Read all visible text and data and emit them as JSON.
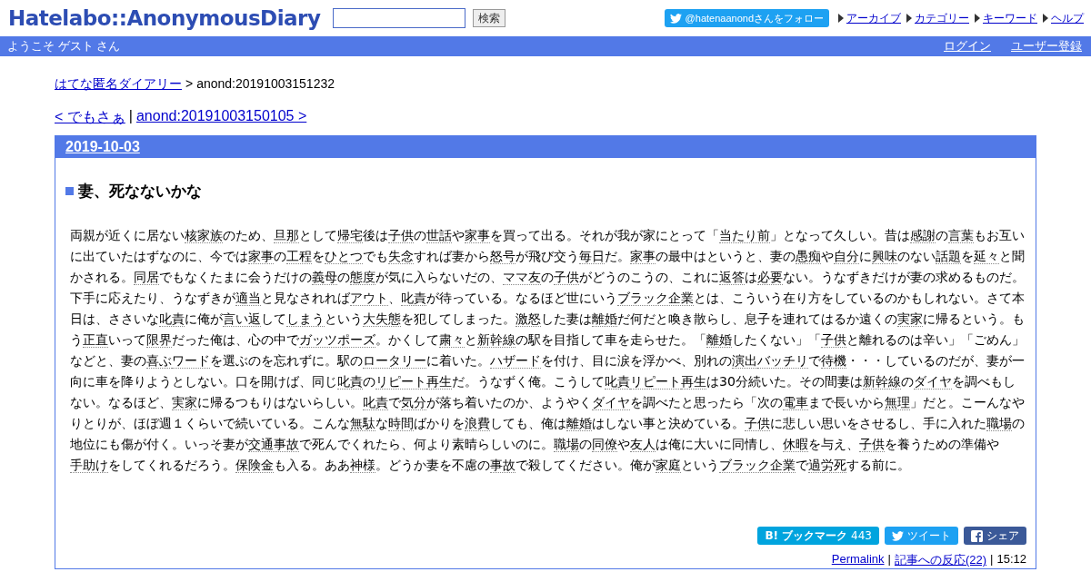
{
  "header": {
    "logo": "Hatelabo::AnonymousDiary",
    "search": {
      "button": "検索"
    },
    "follow": "@hatenaanondさんをフォロー",
    "links": [
      "アーカイブ",
      "カテゴリー",
      "キーワード",
      "ヘルプ"
    ]
  },
  "user_bar": {
    "greeting": "ようこそ ゲスト さん",
    "links": [
      "ログイン",
      "ユーザー登録"
    ]
  },
  "breadcrumb": {
    "link": "はてな匿名ダイアリー",
    "separator": ">",
    "current": "anond:20191003151232"
  },
  "pager": {
    "prev": "< でもさぁ",
    "separator": "|",
    "next": "anond:20191003150105 >"
  },
  "day": {
    "date": "2019-10-03",
    "entry": {
      "title": "妻、死なないかな",
      "body": [
        {
          "text": "両親が近くに居ない",
          "keyword": false
        },
        {
          "text": "核家族",
          "keyword": true
        },
        {
          "text": "のため、",
          "keyword": false
        },
        {
          "text": "旦那",
          "keyword": true
        },
        {
          "text": "として",
          "keyword": false
        },
        {
          "text": "帰宅",
          "keyword": true
        },
        {
          "text": "後は",
          "keyword": false
        },
        {
          "text": "子供",
          "keyword": true
        },
        {
          "text": "の",
          "keyword": false
        },
        {
          "text": "世話",
          "keyword": true
        },
        {
          "text": "や",
          "keyword": false
        },
        {
          "text": "家事",
          "keyword": true
        },
        {
          "text": "を買って出る。それが我が家にとって「",
          "keyword": false
        },
        {
          "text": "当たり前",
          "keyword": true
        },
        {
          "text": "」となって久しい。昔は",
          "keyword": false
        },
        {
          "text": "感謝",
          "keyword": true
        },
        {
          "text": "の",
          "keyword": false
        },
        {
          "text": "言葉",
          "keyword": true
        },
        {
          "text": "もお互いに出ていたはずなのに、今では",
          "keyword": false
        },
        {
          "text": "家事",
          "keyword": true
        },
        {
          "text": "の",
          "keyword": false
        },
        {
          "text": "工程",
          "keyword": true
        },
        {
          "text": "を",
          "keyword": false
        },
        {
          "text": "ひとつ",
          "keyword": true
        },
        {
          "text": "でも",
          "keyword": false
        },
        {
          "text": "失念",
          "keyword": true
        },
        {
          "text": "すれば妻から",
          "keyword": false
        },
        {
          "text": "怒号",
          "keyword": true
        },
        {
          "text": "が飛び交う",
          "keyword": false
        },
        {
          "text": "毎日",
          "keyword": true
        },
        {
          "text": "だ。",
          "keyword": false
        },
        {
          "text": "家事",
          "keyword": true
        },
        {
          "text": "の最中はというと、妻の",
          "keyword": false
        },
        {
          "text": "愚痴",
          "keyword": true
        },
        {
          "text": "や",
          "keyword": false
        },
        {
          "text": "自分",
          "keyword": true
        },
        {
          "text": "に",
          "keyword": false
        },
        {
          "text": "興味",
          "keyword": true
        },
        {
          "text": "のない",
          "keyword": false
        },
        {
          "text": "話題",
          "keyword": true
        },
        {
          "text": "を",
          "keyword": false
        },
        {
          "text": "延々",
          "keyword": true
        },
        {
          "text": "と聞かされる。",
          "keyword": false
        },
        {
          "text": "同居",
          "keyword": true
        },
        {
          "text": "でもなくたまに会うだけの",
          "keyword": false
        },
        {
          "text": "義母",
          "keyword": true
        },
        {
          "text": "の",
          "keyword": false
        },
        {
          "text": "態度",
          "keyword": true
        },
        {
          "text": "が気に入らないだの、",
          "keyword": false
        },
        {
          "text": "ママ友",
          "keyword": true
        },
        {
          "text": "の",
          "keyword": false
        },
        {
          "text": "子供",
          "keyword": true
        },
        {
          "text": "がどうのこうの、これに",
          "keyword": false
        },
        {
          "text": "返答",
          "keyword": true
        },
        {
          "text": "は",
          "keyword": false
        },
        {
          "text": "必要",
          "keyword": true
        },
        {
          "text": "ない。うなずきだけが妻の求めるものだ。下手に応えたり、うなずきが",
          "keyword": false
        },
        {
          "text": "適当",
          "keyword": true
        },
        {
          "text": "と見なされれば",
          "keyword": false
        },
        {
          "text": "アウト",
          "keyword": true
        },
        {
          "text": "、",
          "keyword": false
        },
        {
          "text": "叱責",
          "keyword": true
        },
        {
          "text": "が待っている。なるほど世にいう",
          "keyword": false
        },
        {
          "text": "ブラック企業",
          "keyword": true
        },
        {
          "text": "とは、こういう在り方をしているのかもしれない。さて本日は、ささいな",
          "keyword": false
        },
        {
          "text": "叱責",
          "keyword": true
        },
        {
          "text": "に俺が",
          "keyword": false
        },
        {
          "text": "言い返",
          "keyword": true
        },
        {
          "text": "して",
          "keyword": false
        },
        {
          "text": "しまう",
          "keyword": true
        },
        {
          "text": "という",
          "keyword": false
        },
        {
          "text": "大失態",
          "keyword": true
        },
        {
          "text": "を犯してしまった。",
          "keyword": false
        },
        {
          "text": "激怒",
          "keyword": true
        },
        {
          "text": "した妻は",
          "keyword": false
        },
        {
          "text": "離婚",
          "keyword": true
        },
        {
          "text": "だ何だと喚き散らし、息子を連れてはるか遠くの",
          "keyword": false
        },
        {
          "text": "実家",
          "keyword": true
        },
        {
          "text": "に帰るという。もう",
          "keyword": false
        },
        {
          "text": "正直",
          "keyword": true
        },
        {
          "text": "いって",
          "keyword": false
        },
        {
          "text": "限界",
          "keyword": true
        },
        {
          "text": "だった俺は、心の中で",
          "keyword": false
        },
        {
          "text": "ガッツポーズ",
          "keyword": true
        },
        {
          "text": "。かくして",
          "keyword": false
        },
        {
          "text": "粛々",
          "keyword": true
        },
        {
          "text": "と",
          "keyword": false
        },
        {
          "text": "新幹線",
          "keyword": true
        },
        {
          "text": "の駅を目指して車を走らせた。「",
          "keyword": false
        },
        {
          "text": "離婚",
          "keyword": true
        },
        {
          "text": "したくない」「",
          "keyword": false
        },
        {
          "text": "子供",
          "keyword": true
        },
        {
          "text": "と離れるのは辛い」「ごめん」などと、妻の",
          "keyword": false
        },
        {
          "text": "喜ぶ",
          "keyword": true
        },
        {
          "text": "ワード",
          "keyword": true
        },
        {
          "text": "を選ぶのを忘れずに。駅の",
          "keyword": false
        },
        {
          "text": "ロータリー",
          "keyword": true
        },
        {
          "text": "に着いた。",
          "keyword": false
        },
        {
          "text": "ハザード",
          "keyword": true
        },
        {
          "text": "を付け、目に涙を浮かべ、別れの",
          "keyword": false
        },
        {
          "text": "演出",
          "keyword": true
        },
        {
          "text": "バッチリ",
          "keyword": true
        },
        {
          "text": "で",
          "keyword": false
        },
        {
          "text": "待機",
          "keyword": true
        },
        {
          "text": "・・・しているのだが、妻が一向に車を降りようとしない。口を開けば、同じ",
          "keyword": false
        },
        {
          "text": "叱責",
          "keyword": true
        },
        {
          "text": "の",
          "keyword": false
        },
        {
          "text": "リピート",
          "keyword": true
        },
        {
          "text": "再生",
          "keyword": true
        },
        {
          "text": "だ。うなずく俺。こうして",
          "keyword": false
        },
        {
          "text": "叱責",
          "keyword": true
        },
        {
          "text": "リピート",
          "keyword": true
        },
        {
          "text": "再生",
          "keyword": true
        },
        {
          "text": "は30分続いた。その間妻は",
          "keyword": false
        },
        {
          "text": "新幹線",
          "keyword": true
        },
        {
          "text": "の",
          "keyword": false
        },
        {
          "text": "ダイヤ",
          "keyword": true
        },
        {
          "text": "を調べもしない。なるほど、",
          "keyword": false
        },
        {
          "text": "実家",
          "keyword": true
        },
        {
          "text": "に帰るつもりはないらしい。",
          "keyword": false
        },
        {
          "text": "叱責",
          "keyword": true
        },
        {
          "text": "で",
          "keyword": false
        },
        {
          "text": "気分",
          "keyword": true
        },
        {
          "text": "が落ち着いたのか、ようやく",
          "keyword": false
        },
        {
          "text": "ダイヤ",
          "keyword": true
        },
        {
          "text": "を調べたと思ったら「次の",
          "keyword": false
        },
        {
          "text": "電車",
          "keyword": true
        },
        {
          "text": "まで長いから",
          "keyword": false
        },
        {
          "text": "無理",
          "keyword": true
        },
        {
          "text": "」だと。こーんなやりとりが、ほぼ週１くらいで続いている。こんな",
          "keyword": false
        },
        {
          "text": "無駄",
          "keyword": true
        },
        {
          "text": "な",
          "keyword": false
        },
        {
          "text": "時間",
          "keyword": true
        },
        {
          "text": "ばかりを",
          "keyword": false
        },
        {
          "text": "浪費",
          "keyword": true
        },
        {
          "text": "しても、俺は",
          "keyword": false
        },
        {
          "text": "離婚",
          "keyword": true
        },
        {
          "text": "はしない事と決めている。",
          "keyword": false
        },
        {
          "text": "子供",
          "keyword": true
        },
        {
          "text": "に悲しい思いをさせるし、手に入れた",
          "keyword": false
        },
        {
          "text": "職場",
          "keyword": true
        },
        {
          "text": "の地位にも傷が付く。いっそ妻が",
          "keyword": false
        },
        {
          "text": "交通事故",
          "keyword": true
        },
        {
          "text": "で死んでくれたら、何より素晴らしいのに。",
          "keyword": false
        },
        {
          "text": "職場",
          "keyword": true
        },
        {
          "text": "の",
          "keyword": false
        },
        {
          "text": "同僚",
          "keyword": true
        },
        {
          "text": "や",
          "keyword": false
        },
        {
          "text": "友人",
          "keyword": true
        },
        {
          "text": "は俺に大いに同情し、",
          "keyword": false
        },
        {
          "text": "休暇",
          "keyword": true
        },
        {
          "text": "を与え、",
          "keyword": false
        },
        {
          "text": "子供",
          "keyword": true
        },
        {
          "text": "を養うための準備や",
          "keyword": false
        },
        {
          "text": "手助け",
          "keyword": true
        },
        {
          "text": "をしてくれるだろう。",
          "keyword": false
        },
        {
          "text": "保険金",
          "keyword": true
        },
        {
          "text": "も入る。ああ",
          "keyword": false
        },
        {
          "text": "神様",
          "keyword": true
        },
        {
          "text": "。どうか妻を不慮の",
          "keyword": false
        },
        {
          "text": "事故",
          "keyword": true
        },
        {
          "text": "で殺してください。俺が",
          "keyword": false
        },
        {
          "text": "家庭",
          "keyword": true
        },
        {
          "text": "という",
          "keyword": false
        },
        {
          "text": "ブラック企業",
          "keyword": true
        },
        {
          "text": "で",
          "keyword": false
        },
        {
          "text": "過労死",
          "keyword": true
        },
        {
          "text": "する前に。",
          "keyword": false
        }
      ],
      "share": [
        {
          "kind": "bookmark",
          "mark": "B!",
          "label": "ブックマーク",
          "count": "443"
        },
        {
          "kind": "tweet",
          "label": "ツイート"
        },
        {
          "kind": "share",
          "label": "シェア"
        }
      ],
      "footer": {
        "permalink": "Permalink",
        "separator": "|",
        "responses": "記事への反応(22)",
        "time": "15:12"
      }
    }
  }
}
